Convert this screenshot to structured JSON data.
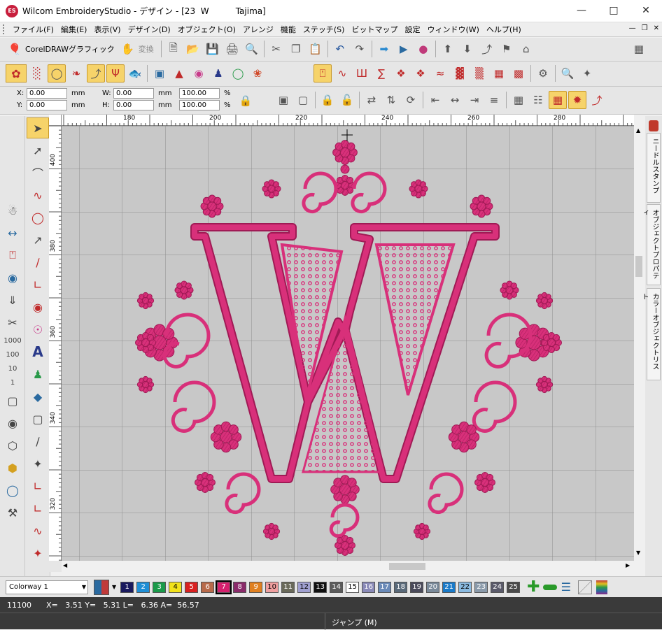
{
  "window": {
    "logo": "ES",
    "title": "Wilcom EmbroideryStudio - デザイン - [23  W          Tajima]"
  },
  "menu": [
    "ファイル(F)",
    "編集(E)",
    "表示(V)",
    "デザイン(D)",
    "オブジェクト(O)",
    "アレンジ",
    "機能",
    "ステッチ(S)",
    "ビットマップ",
    "設定",
    "ウィンドウ(W)",
    "ヘルプ(H)"
  ],
  "toolbar": {
    "coreldraw_label": "CorelDRAWグラフィック",
    "convert_label": "変換"
  },
  "coords": {
    "x_label": "X:",
    "x_value": "0.00",
    "y_label": "Y:",
    "y_value": "0.00",
    "unit": "mm",
    "w_label": "W:",
    "w_value": "0.00",
    "h_label": "H:",
    "h_value": "0.00",
    "scale_w": "100.00",
    "scale_h": "100.00",
    "pct": "%"
  },
  "ruler_h": [
    "180",
    "200",
    "220",
    "240",
    "260",
    "280"
  ],
  "ruler_v": [
    "400",
    "380",
    "360",
    "340",
    "320"
  ],
  "left_numbers": [
    "1000",
    "100",
    "10",
    "1"
  ],
  "side_tabs": [
    "ニードルスタンプ",
    "オブジェクトプロパティ",
    "カラーオブジェクトリスト"
  ],
  "colorway": "Colorway 1",
  "colors": [
    {
      "n": "1",
      "c": "#1a1a5e"
    },
    {
      "n": "2",
      "c": "#1f8fd6"
    },
    {
      "n": "3",
      "c": "#1a9a4a"
    },
    {
      "n": "4",
      "c": "#f2e21a"
    },
    {
      "n": "5",
      "c": "#d92020"
    },
    {
      "n": "6",
      "c": "#b86a4a"
    },
    {
      "n": "7",
      "c": "#d6206e"
    },
    {
      "n": "8",
      "c": "#8a2a6a"
    },
    {
      "n": "9",
      "c": "#e08020"
    },
    {
      "n": "10",
      "c": "#f0a0a0"
    },
    {
      "n": "11",
      "c": "#6a6a5a"
    },
    {
      "n": "12",
      "c": "#a0a0d0"
    },
    {
      "n": "13",
      "c": "#101010"
    },
    {
      "n": "14",
      "c": "#5a5a5a"
    },
    {
      "n": "15",
      "c": "#ffffff"
    },
    {
      "n": "16",
      "c": "#8a8ab8"
    },
    {
      "n": "17",
      "c": "#6a8ab8"
    },
    {
      "n": "18",
      "c": "#5a6a7a"
    },
    {
      "n": "19",
      "c": "#4a4a5a"
    },
    {
      "n": "20",
      "c": "#7a8a9a"
    },
    {
      "n": "21",
      "c": "#1a7ac8"
    },
    {
      "n": "22",
      "c": "#8abae0"
    },
    {
      "n": "23",
      "c": "#8a9aaa"
    },
    {
      "n": "24",
      "c": "#5a5a6a"
    },
    {
      "n": "25",
      "c": "#4a4a4a"
    }
  ],
  "status": {
    "stitches": "11100",
    "readout": "X=   3.51 Y=   5.31 L=   6.36 A=  56.57"
  },
  "bottom": {
    "mode": "ジャンプ (M)"
  },
  "design": {
    "thread_color": "#d8307a",
    "dark_color": "#9a1a50"
  }
}
